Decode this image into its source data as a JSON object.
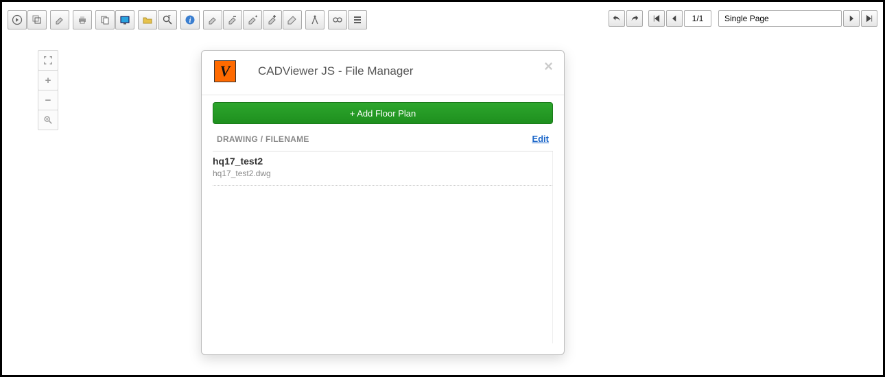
{
  "toolbar": {
    "icons": [
      "arrow-right-circle",
      "layers",
      "eraser-small",
      "print",
      "copy",
      "screen",
      "folder-open",
      "zoom-text",
      "info",
      "eraser-a",
      "eraser-minus",
      "eraser-star",
      "eraser-plus",
      "eraser-big",
      "compass",
      "link",
      "menu"
    ]
  },
  "rightControls": {
    "undo": "undo",
    "redo": "redo",
    "first": "first",
    "prev": "prev",
    "page": "1/1",
    "mode": "Single Page",
    "next": "next",
    "last": "last"
  },
  "zoomPanel": {
    "extents": "⛶",
    "in": "+",
    "out": "−",
    "window": "⊕"
  },
  "modal": {
    "title": "CADViewer JS - File Manager",
    "close": "×",
    "addBtn": "+ Add Floor Plan",
    "listHeader": "DRAWING / FILENAME",
    "editLabel": "Edit",
    "files": [
      {
        "name": "hq17_test2",
        "filename": "hq17_test2.dwg"
      }
    ]
  }
}
